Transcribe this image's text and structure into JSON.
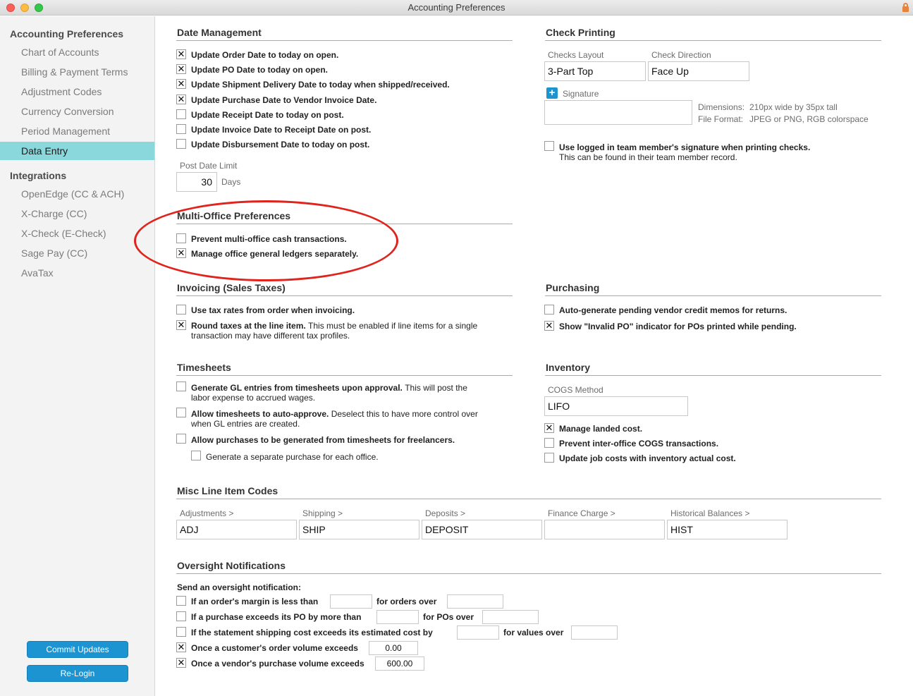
{
  "window": {
    "title": "Accounting Preferences"
  },
  "sidebar": {
    "heading": "Accounting Preferences",
    "items": [
      "Chart of Accounts",
      "Billing & Payment Terms",
      "Adjustment Codes",
      "Currency Conversion",
      "Period Management",
      "Data Entry"
    ],
    "integrations_heading": "Integrations",
    "integrations": [
      "OpenEdge (CC & ACH)",
      "X-Charge (CC)",
      "X-Check (E-Check)",
      "Sage Pay (CC)",
      "AvaTax"
    ],
    "commit_label": "Commit Updates",
    "relogin_label": "Re-Login"
  },
  "date_management": {
    "title": "Date Management",
    "options": [
      {
        "label": "Update Order Date to today on open.",
        "checked": true
      },
      {
        "label": "Update PO Date to today on open.",
        "checked": true
      },
      {
        "label": "Update Shipment Delivery Date to today when shipped/received.",
        "checked": true
      },
      {
        "label": "Update Purchase Date to Vendor Invoice Date.",
        "checked": true
      },
      {
        "label": "Update Receipt Date to today on post.",
        "checked": false
      },
      {
        "label": "Update Invoice Date to Receipt Date on post.",
        "checked": false
      },
      {
        "label": "Update Disbursement Date to today on post.",
        "checked": false
      }
    ],
    "post_date_limit_label": "Post Date Limit",
    "post_date_limit_value": "30",
    "days_label": "Days"
  },
  "check_printing": {
    "title": "Check Printing",
    "layout_label": "Checks Layout",
    "layout_value": "3-Part Top",
    "direction_label": "Check Direction",
    "direction_value": "Face Up",
    "signature_label": "Signature",
    "dimensions_label": "Dimensions:",
    "dimensions_value": "210px wide by 35px tall",
    "file_format_label": "File Format:",
    "file_format_value": "JPEG or PNG, RGB colorspace",
    "use_signature_label": "Use logged in team member's signature when printing checks.",
    "use_signature_note": "This can be found in their team member record.",
    "use_signature_checked": false
  },
  "multi_office": {
    "title": "Multi-Office Preferences",
    "options": [
      {
        "label": "Prevent multi-office cash transactions.",
        "checked": false
      },
      {
        "label": "Manage office general ledgers separately.",
        "checked": true
      }
    ]
  },
  "invoicing": {
    "title": "Invoicing (Sales Taxes)",
    "use_tax_rates_label": "Use tax rates from order when invoicing.",
    "use_tax_rates_checked": false,
    "round_taxes_label": "Round taxes at the line item.",
    "round_taxes_note1": "This must be enabled if line items for a single",
    "round_taxes_note2": "transaction may have different tax profiles.",
    "round_taxes_checked": true
  },
  "purchasing": {
    "title": "Purchasing",
    "options": [
      {
        "label": "Auto-generate pending vendor credit memos for returns.",
        "checked": false
      },
      {
        "label": "Show \"Invalid PO\" indicator for POs printed while pending.",
        "checked": true
      }
    ]
  },
  "timesheets": {
    "title": "Timesheets",
    "gl_label": "Generate GL entries from timesheets upon approval.",
    "gl_note1": "This will post the",
    "gl_note2": "labor expense to accrued wages.",
    "gl_checked": false,
    "auto_label": "Allow timesheets to auto-approve.",
    "auto_note1": "Deselect this to have more control over",
    "auto_note2": "when GL entries are created.",
    "auto_checked": false,
    "purch_label": "Allow purchases to be generated from timesheets for freelancers.",
    "purch_checked": false,
    "separate_label": "Generate a separate purchase for each office.",
    "separate_checked": false
  },
  "inventory": {
    "title": "Inventory",
    "cogs_label": "COGS Method",
    "cogs_value": "LIFO",
    "options": [
      {
        "label": "Manage landed cost.",
        "checked": true
      },
      {
        "label": "Prevent inter-office COGS transactions.",
        "checked": false
      },
      {
        "label": "Update job costs with inventory actual cost.",
        "checked": false
      }
    ]
  },
  "misc_codes": {
    "title": "Misc Line Item Codes",
    "fields": [
      {
        "label": "Adjustments >",
        "value": "ADJ"
      },
      {
        "label": "Shipping >",
        "value": "SHIP"
      },
      {
        "label": "Deposits >",
        "value": "DEPOSIT"
      },
      {
        "label": "Finance Charge >",
        "value": ""
      },
      {
        "label": "Historical Balances >",
        "value": "HIST"
      }
    ]
  },
  "oversight": {
    "title": "Oversight Notifications",
    "intro": "Send an oversight notification:",
    "margin_label": "If an order's margin is less than",
    "margin_value": "",
    "orders_over_label": "for orders over",
    "orders_over_value": "",
    "margin_checked": false,
    "po_label": "If a purchase exceeds its PO by more than",
    "po_value": "",
    "pos_over_label": "for POs over",
    "pos_over_value": "",
    "po_checked": false,
    "shipping_label": "If the statement shipping cost exceeds its estimated cost by",
    "shipping_value": "",
    "values_over_label": "for values over",
    "values_over_value": "",
    "shipping_checked": false,
    "customer_label": "Once a customer's order volume exceeds",
    "customer_value": "0.00",
    "customer_checked": true,
    "vendor_label": "Once a vendor's purchase volume exceeds",
    "vendor_value": "600.00",
    "vendor_checked": true
  }
}
